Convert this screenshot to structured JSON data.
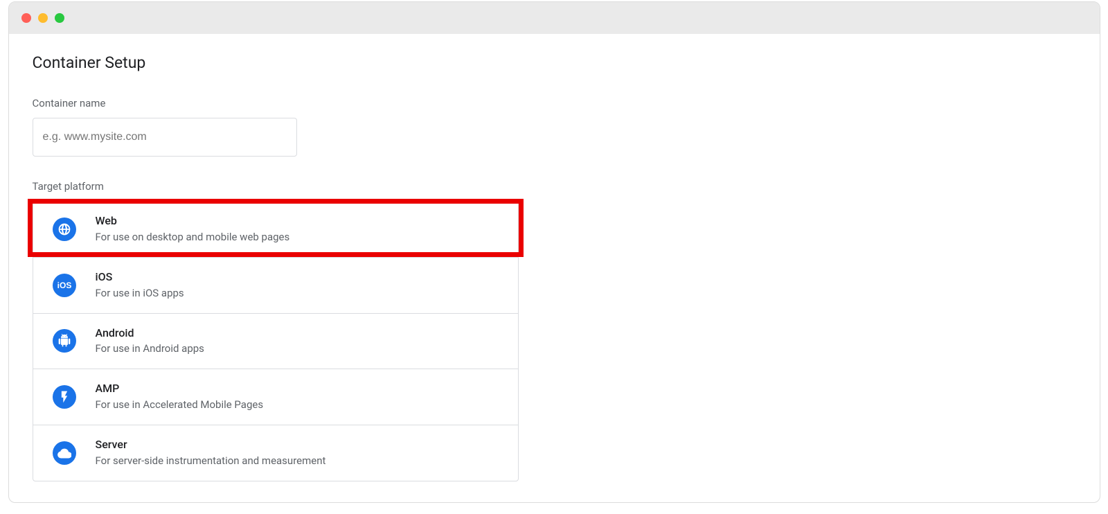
{
  "page_title": "Container Setup",
  "container_name": {
    "label": "Container name",
    "placeholder": "e.g. www.mysite.com",
    "value": ""
  },
  "target_platform_label": "Target platform",
  "platforms": [
    {
      "id": "web",
      "title": "Web",
      "desc": "For use on desktop and mobile web pages",
      "highlighted": true
    },
    {
      "id": "ios",
      "title": "iOS",
      "desc": "For use in iOS apps",
      "highlighted": false
    },
    {
      "id": "android",
      "title": "Android",
      "desc": "For use in Android apps",
      "highlighted": false
    },
    {
      "id": "amp",
      "title": "AMP",
      "desc": "For use in Accelerated Mobile Pages",
      "highlighted": false
    },
    {
      "id": "server",
      "title": "Server",
      "desc": "For server-side instrumentation and measurement",
      "highlighted": false
    }
  ],
  "colors": {
    "accent": "#1a73e8",
    "highlight_border": "#ea0000",
    "text_primary": "#202124",
    "text_secondary": "#5f6368",
    "border": "#dadce0"
  }
}
